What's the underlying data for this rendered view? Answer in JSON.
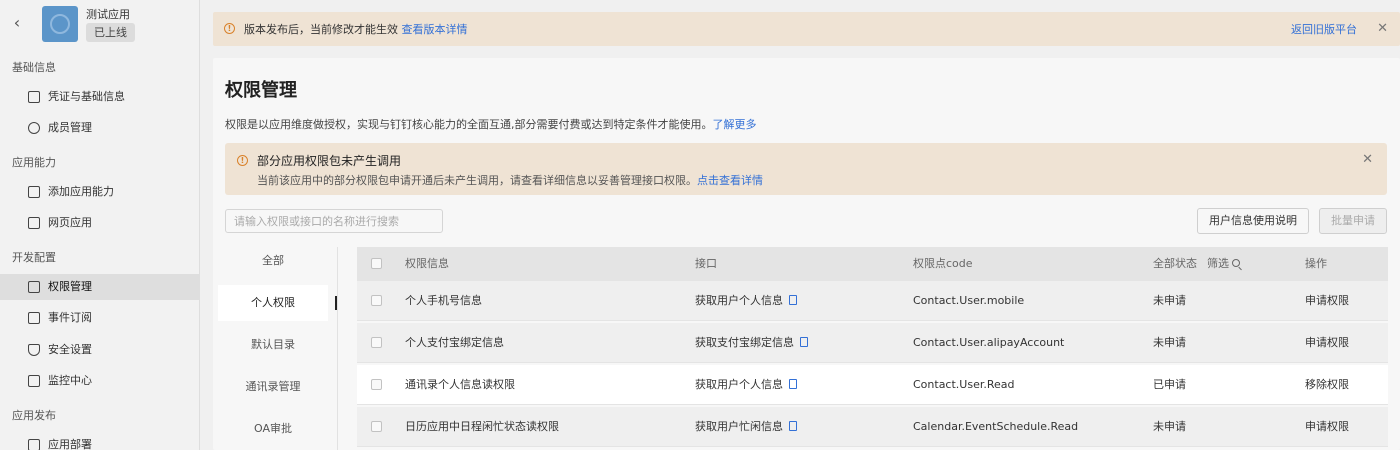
{
  "app": {
    "name": "测试应用",
    "status_badge": "已上线",
    "back_icon": "chevron-left-icon"
  },
  "sidebar": {
    "sections": [
      {
        "title": "基础信息",
        "items": [
          {
            "label": "凭证与基础信息",
            "icon": "credential-icon"
          },
          {
            "label": "成员管理",
            "icon": "user-icon"
          }
        ]
      },
      {
        "title": "应用能力",
        "items": [
          {
            "label": "添加应用能力",
            "icon": "add-capability-icon"
          },
          {
            "label": "网页应用",
            "icon": "webpage-icon"
          }
        ]
      },
      {
        "title": "开发配置",
        "items": [
          {
            "label": "权限管理",
            "icon": "lock-icon",
            "active": true
          },
          {
            "label": "事件订阅",
            "icon": "event-icon"
          },
          {
            "label": "安全设置",
            "icon": "shield-icon"
          },
          {
            "label": "监控中心",
            "icon": "monitor-icon"
          }
        ]
      },
      {
        "title": "应用发布",
        "items": [
          {
            "label": "应用部署",
            "icon": "deploy-icon"
          }
        ]
      }
    ]
  },
  "banner": {
    "text": "版本发布后，当前修改才能生效",
    "link": "查看版本详情",
    "right_link": "返回旧版平台",
    "accent_color": "#d9822b"
  },
  "page": {
    "title": "权限管理",
    "description": "权限是以应用维度做授权，实现与钉钉核心能力的全面互通,部分需要付费或达到特定条件才能使用。",
    "learn_more": "了解更多"
  },
  "alert": {
    "title": "部分应用权限包未产生调用",
    "text": "当前该应用中的部分权限包申请开通后未产生调用，请查看详细信息以妥善管理接口权限。",
    "link": "点击查看详情"
  },
  "toolbar": {
    "search_placeholder": "请输入权限或接口的名称进行搜索",
    "guide_button": "用户信息使用说明",
    "batch_button": "批量申请"
  },
  "categories": [
    {
      "label": "全部"
    },
    {
      "label": "个人权限",
      "active": true
    },
    {
      "label": "默认目录"
    },
    {
      "label": "通讯录管理"
    },
    {
      "label": "OA审批"
    }
  ],
  "table": {
    "headers": {
      "info": "权限信息",
      "api": "接口",
      "code": "权限点code",
      "status": "全部状态",
      "filter": "筛选",
      "action": "操作"
    },
    "rows": [
      {
        "name": "个人手机号信息",
        "api": "获取用户个人信息",
        "code": "Contact.User.mobile",
        "status": "未申请",
        "action": "申请权限",
        "action_type": "apply"
      },
      {
        "name": "个人支付宝绑定信息",
        "api": "获取支付宝绑定信息",
        "code": "Contact.User.alipayAccount",
        "status": "未申请",
        "action": "申请权限",
        "action_type": "apply"
      },
      {
        "name": "通讯录个人信息读权限",
        "api": "获取用户个人信息",
        "code": "Contact.User.Read",
        "status": "已申请",
        "action": "移除权限",
        "action_type": "remove"
      },
      {
        "name": "日历应用中日程闲忙状态读权限",
        "api": "获取用户忙闲信息",
        "code": "Calendar.EventSchedule.Read",
        "status": "未申请",
        "action": "申请权限",
        "action_type": "apply"
      }
    ]
  },
  "colors": {
    "link": "#3370d6",
    "remove": "#e0522f",
    "warning_bg": "#efe3d4"
  }
}
